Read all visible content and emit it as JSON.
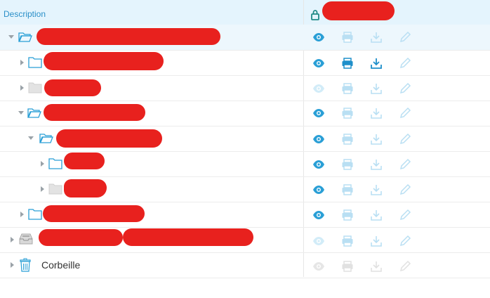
{
  "header": {
    "description_label": "Description"
  },
  "colors": {
    "accent": "#2a9fd6",
    "accent_dim": "#b9dff3",
    "redaction": "#e8211e",
    "header_bg": "#e4f4fd"
  },
  "rows": [
    {
      "folder_icon": "folder-open-icon",
      "expanded": true,
      "selected": true,
      "label": "",
      "actions": {
        "view": "active",
        "print": "dim",
        "download": "dim",
        "edit": "dim"
      }
    },
    {
      "folder_icon": "folder-icon",
      "expanded": false,
      "selected": false,
      "label": "",
      "actions": {
        "view": "active",
        "print": "active",
        "download": "active",
        "edit": "dim"
      }
    },
    {
      "folder_icon": "folder-gray-icon",
      "expanded": false,
      "selected": false,
      "label": "",
      "actions": {
        "view": "dim",
        "print": "dim",
        "download": "dim",
        "edit": "dim"
      }
    },
    {
      "folder_icon": "folder-open-icon",
      "expanded": true,
      "selected": false,
      "label": "",
      "actions": {
        "view": "active",
        "print": "dim",
        "download": "dim",
        "edit": "dim"
      }
    },
    {
      "folder_icon": "folder-open-icon",
      "expanded": true,
      "selected": false,
      "label": "",
      "actions": {
        "view": "active",
        "print": "dim",
        "download": "dim",
        "edit": "dim"
      }
    },
    {
      "folder_icon": "folder-icon",
      "expanded": false,
      "selected": false,
      "label": "",
      "actions": {
        "view": "active",
        "print": "dim",
        "download": "dim",
        "edit": "dim"
      }
    },
    {
      "folder_icon": "folder-gray-icon",
      "expanded": false,
      "selected": false,
      "label": "",
      "actions": {
        "view": "active",
        "print": "dim",
        "download": "dim",
        "edit": "dim"
      }
    },
    {
      "folder_icon": "folder-icon",
      "expanded": false,
      "selected": false,
      "label": "",
      "actions": {
        "view": "active",
        "print": "dim",
        "download": "dim",
        "edit": "dim"
      }
    },
    {
      "folder_icon": "inbox-tray-icon",
      "expanded": false,
      "selected": false,
      "label": "",
      "actions": {
        "view": "dim",
        "print": "dim",
        "download": "dim",
        "edit": "dim"
      }
    },
    {
      "folder_icon": "trash-icon",
      "expanded": false,
      "selected": false,
      "label": "Corbeille",
      "actions": {
        "view": "gray",
        "print": "gray",
        "download": "gray",
        "edit": "gray"
      }
    }
  ]
}
